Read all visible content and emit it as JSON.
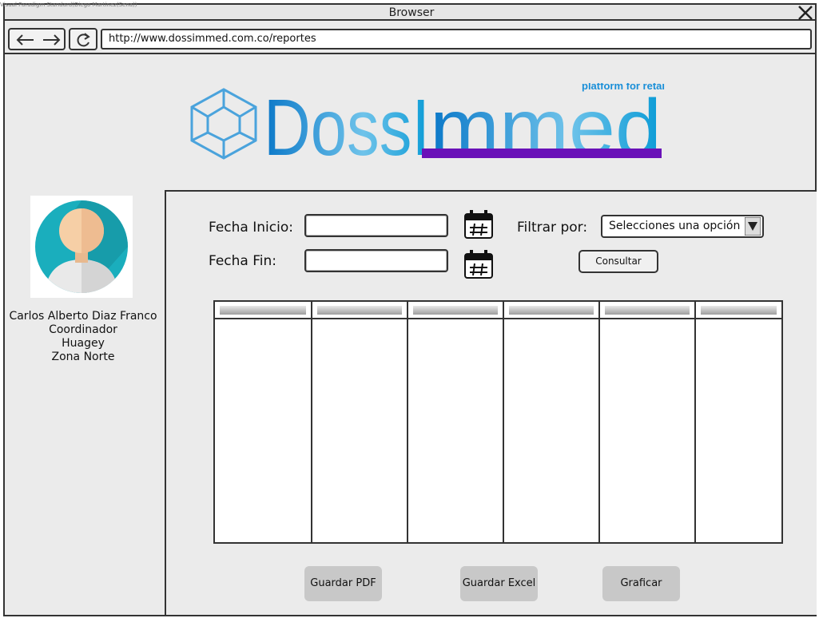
{
  "browser": {
    "watermark": "Visual Paradigm Standard(Diego Martinez(Sena))",
    "title": "Browser",
    "url": "http://www.dossimmed.com.co/reportes"
  },
  "logo": {
    "name_part1": "DossI",
    "name_part2": "mmed",
    "tagline": "platform for retail",
    "colors": {
      "blue": "#1a8fd8",
      "purple": "#6a11b8"
    }
  },
  "user": {
    "name": "Carlos Alberto Diaz Franco",
    "role": "Coordinador",
    "company": "Huagey",
    "zone": "Zona Norte"
  },
  "filters": {
    "start_label": "Fecha Inicio:",
    "end_label": "Fecha Fin:",
    "start_value": "",
    "end_value": "",
    "filter_label": "Filtrar por:",
    "filter_selected": "Selecciones una opción",
    "consult_button": "Consultar"
  },
  "table": {
    "columns": [
      "",
      "",
      "",
      "",
      "",
      ""
    ]
  },
  "actions": {
    "pdf": "Guardar PDF",
    "excel": "Guardar Excel",
    "chart": "Graficar"
  }
}
